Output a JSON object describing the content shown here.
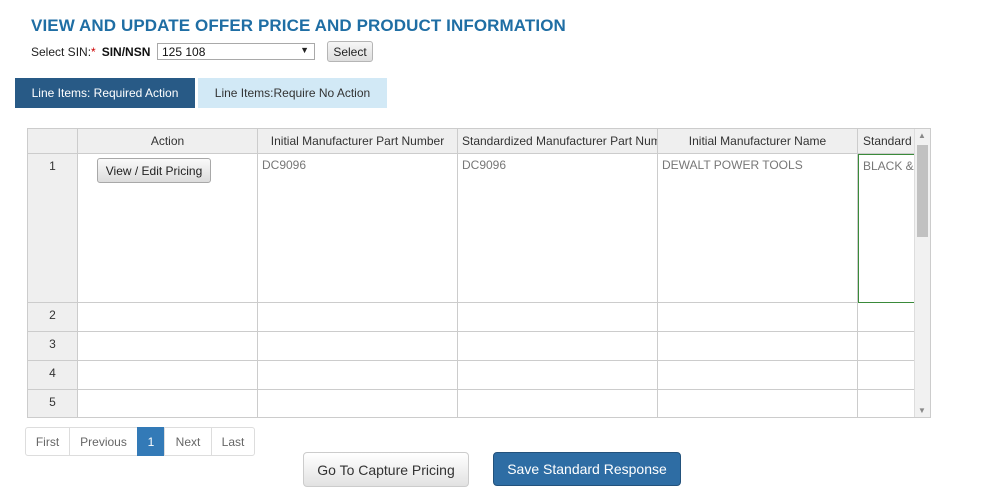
{
  "page": {
    "title": "VIEW AND UPDATE OFFER PRICE AND PRODUCT INFORMATION"
  },
  "sin_selector": {
    "label": "Select SIN:",
    "required_mark": "*",
    "type_label": "SIN/NSN",
    "selected_value": "125 108",
    "button_label": "Select"
  },
  "tabs": [
    {
      "label": "Line Items: Required Action",
      "active": true
    },
    {
      "label": "Line Items:Require No Action",
      "active": false
    }
  ],
  "grid": {
    "columns": [
      "Action",
      "Initial Manufacturer Part Number",
      "Standardized Manufacturer Part Number",
      "Initial Manufacturer Name",
      "Standard"
    ],
    "rows": [
      {
        "num": "1",
        "action_button": "View / Edit Pricing",
        "initial_part": "DC9096",
        "std_part": "DC9096",
        "initial_mfr": "DEWALT POWER TOOLS",
        "std_mfr": "BLACK &"
      },
      {
        "num": "2"
      },
      {
        "num": "3"
      },
      {
        "num": "4"
      },
      {
        "num": "5"
      }
    ]
  },
  "pager": {
    "first": "First",
    "previous": "Previous",
    "current": "1",
    "next": "Next",
    "last": "Last"
  },
  "actions": {
    "capture_label": "Go To Capture Pricing",
    "save_label": "Save Standard Response"
  },
  "colors": {
    "title": "#1f6ea4",
    "tab_active": "#285a86",
    "tab_inactive": "#d2e9f6",
    "primary_button": "#2e6da4"
  }
}
